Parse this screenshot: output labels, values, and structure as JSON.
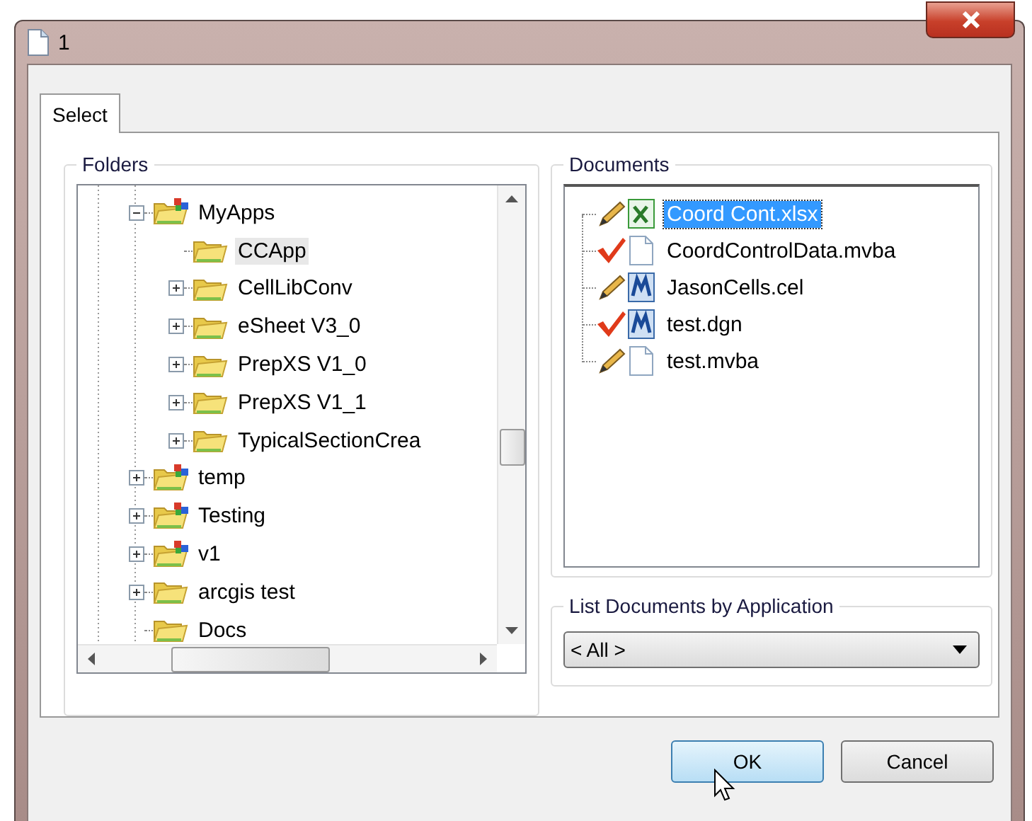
{
  "window": {
    "title": "1"
  },
  "tabs": [
    {
      "label": "Select",
      "selected": true
    }
  ],
  "folders": {
    "title": "Folders",
    "tree": [
      {
        "label": "MyApps",
        "kind": "app_folder",
        "expanded": true,
        "selected": false,
        "children": [
          {
            "label": "CCApp",
            "kind": "folder",
            "selected": true
          },
          {
            "label": "CellLibConv",
            "kind": "folder",
            "expanded": false,
            "selected": false
          },
          {
            "label": "eSheet V3_0",
            "kind": "folder",
            "expanded": false,
            "selected": false
          },
          {
            "label": "PrepXS V1_0",
            "kind": "folder",
            "expanded": false,
            "selected": false
          },
          {
            "label": "PrepXS V1_1",
            "kind": "folder",
            "expanded": false,
            "selected": false
          },
          {
            "label": "TypicalSectionCrea",
            "kind": "folder",
            "expanded": false,
            "selected": false
          }
        ]
      },
      {
        "label": "temp",
        "kind": "app_folder",
        "expanded": false,
        "selected": false
      },
      {
        "label": "Testing",
        "kind": "app_folder",
        "expanded": false,
        "selected": false
      },
      {
        "label": "v1",
        "kind": "app_folder",
        "expanded": false,
        "selected": false
      },
      {
        "label": "arcgis test",
        "kind": "folder",
        "expanded": false,
        "selected": false
      },
      {
        "label": "Docs",
        "kind": "folder",
        "selected": false
      }
    ]
  },
  "documents": {
    "title": "Documents",
    "items": [
      {
        "label": "Coord Cont.xlsx",
        "checked": false,
        "kind": "spreadsheet",
        "selected": true
      },
      {
        "label": "CoordControlData.mvba",
        "checked": true,
        "kind": "file",
        "selected": false
      },
      {
        "label": "JasonCells.cel",
        "checked": false,
        "kind": "cad",
        "selected": false
      },
      {
        "label": "test.dgn",
        "checked": true,
        "kind": "cad",
        "selected": false
      },
      {
        "label": "test.mvba",
        "checked": false,
        "kind": "file",
        "selected": false
      }
    ]
  },
  "filter": {
    "title": "List Documents by Application",
    "value": "< All >"
  },
  "buttons": [
    {
      "label": "OK",
      "default": true
    },
    {
      "label": "Cancel",
      "default": false
    }
  ]
}
